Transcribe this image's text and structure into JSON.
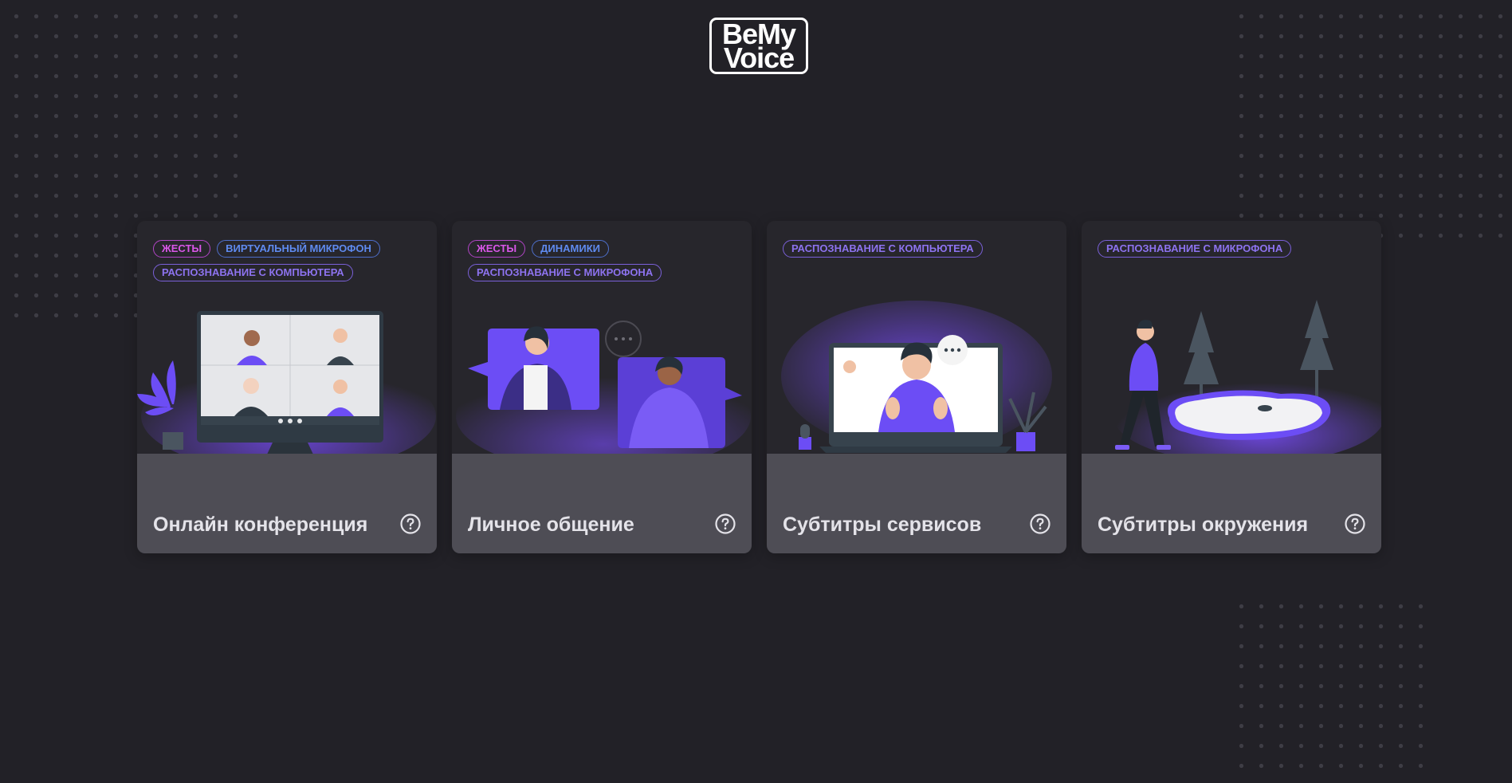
{
  "logo": {
    "line1": "BeMy",
    "line2": "Voice"
  },
  "cards": [
    {
      "title": "Онлайн конференция",
      "tags": [
        {
          "label": "ЖЕСТЫ",
          "color": "#d957e8"
        },
        {
          "label": "ВИРТУАЛЬНЫЙ МИКРОФОН",
          "color": "#5f8bf0"
        },
        {
          "label": "РАСПОЗНАВАНИЕ С КОМПЬЮТЕРА",
          "color": "#8d73ef"
        }
      ],
      "help_icon": "question-circle-icon"
    },
    {
      "title": "Личное общение",
      "tags": [
        {
          "label": "ЖЕСТЫ",
          "color": "#d957e8"
        },
        {
          "label": "ДИНАМИКИ",
          "color": "#5f8bf0"
        },
        {
          "label": "РАСПОЗНАВАНИЕ С МИКРОФОНА",
          "color": "#8d73ef"
        }
      ],
      "help_icon": "question-circle-icon"
    },
    {
      "title": "Субтитры сервисов",
      "tags": [
        {
          "label": "РАСПОЗНАВАНИЕ С КОМПЬЮТЕРА",
          "color": "#8d73ef"
        }
      ],
      "help_icon": "question-circle-icon"
    },
    {
      "title": "Субтитры окружения",
      "tags": [
        {
          "label": "РАСПОЗНАВАНИЕ С МИКРОФОНА",
          "color": "#8d73ef"
        }
      ],
      "help_icon": "question-circle-icon"
    }
  ],
  "colors": {
    "background": "#222127",
    "card": "#27262c",
    "card_bottom": "#4e4d55",
    "accent": "#6c4df5",
    "title_text": "#e4e3e9"
  }
}
